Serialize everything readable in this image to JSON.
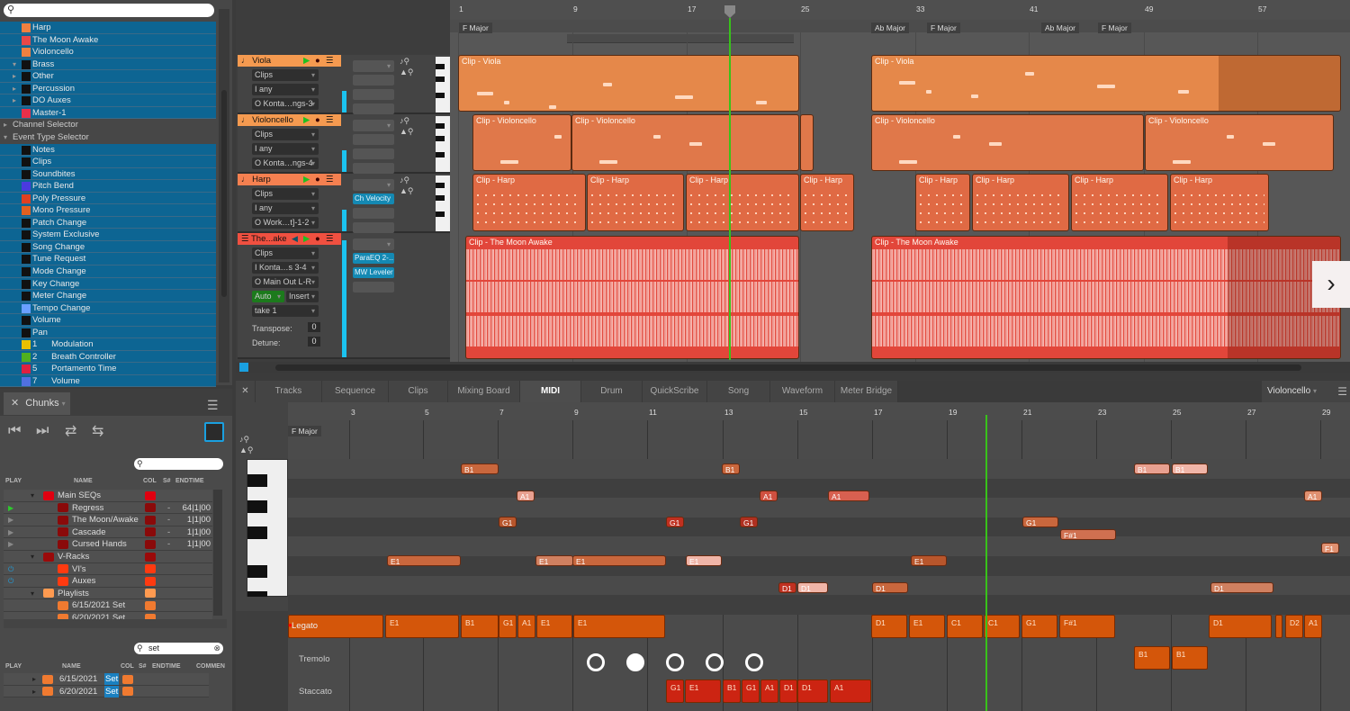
{
  "browser": {
    "search_placeholder": "",
    "items": [
      {
        "label": "Harp",
        "icon": "midi-track-icon",
        "color": "#f08040",
        "indent": 2,
        "sel": true
      },
      {
        "label": "The Moon Awake",
        "icon": "audio-track-icon",
        "color": "#e84848",
        "indent": 2,
        "sel": true
      },
      {
        "label": "Violoncello",
        "icon": "midi-track-icon",
        "color": "#f08040",
        "indent": 2,
        "sel": true
      },
      {
        "label": "Brass",
        "icon": "folder-icon",
        "color": "#111",
        "indent": 1,
        "sel": true,
        "arrow": "▾"
      },
      {
        "label": "Other",
        "icon": "folder-icon",
        "color": "#111",
        "indent": 1,
        "sel": true,
        "arrow": "▸"
      },
      {
        "label": "Percussion",
        "icon": "folder-icon",
        "color": "#111",
        "indent": 1,
        "sel": true,
        "arrow": "▸"
      },
      {
        "label": "DO Auxes",
        "icon": "folder-icon",
        "color": "#111",
        "indent": 1,
        "sel": true,
        "arrow": "▸"
      },
      {
        "label": "Master-1",
        "icon": "master-bus-icon",
        "color": "#e8304a",
        "indent": 2,
        "sel": true
      },
      {
        "label": "Channel Selector",
        "indent": 0,
        "sel": false,
        "arrow": "▸"
      },
      {
        "label": "Event Type Selector",
        "indent": 0,
        "sel": false,
        "arrow": "▾"
      },
      {
        "label": "Notes",
        "icon": "note-icon",
        "color": "#111",
        "indent": 2,
        "sel": true
      },
      {
        "label": "Clips",
        "icon": "clips-icon",
        "color": "#111",
        "indent": 2,
        "sel": true
      },
      {
        "label": "Soundbites",
        "icon": "soundbites-icon",
        "color": "#111",
        "indent": 2,
        "sel": true
      },
      {
        "label": "Pitch Bend",
        "icon": "pitch-bend-icon",
        "color": "#4a3ae0",
        "indent": 2,
        "sel": true
      },
      {
        "label": "Poly Pressure",
        "icon": "poly-pressure-icon",
        "color": "#e04020",
        "indent": 2,
        "sel": true
      },
      {
        "label": "Mono Pressure",
        "icon": "mono-pressure-icon",
        "color": "#e06020",
        "indent": 2,
        "sel": true
      },
      {
        "label": "Patch Change",
        "icon": "patch-change-icon",
        "color": "#111",
        "indent": 2,
        "sel": true
      },
      {
        "label": "System Exclusive",
        "icon": "sysex-icon",
        "color": "#111",
        "indent": 2,
        "sel": true
      },
      {
        "label": "Song Change",
        "icon": "song-change-icon",
        "color": "#111",
        "indent": 2,
        "sel": true
      },
      {
        "label": "Tune Request",
        "icon": "tune-request-icon",
        "color": "#111",
        "indent": 2,
        "sel": true
      },
      {
        "label": "Mode Change",
        "icon": "mode-change-icon",
        "color": "#111",
        "indent": 2,
        "sel": true
      },
      {
        "label": "Key Change",
        "icon": "key-change-icon",
        "color": "#111",
        "indent": 2,
        "sel": true
      },
      {
        "label": "Meter Change",
        "icon": "meter-change-icon",
        "color": "#111",
        "indent": 2,
        "sel": true
      },
      {
        "label": "Tempo Change",
        "icon": "tempo-change-icon",
        "color": "#6aa0ff",
        "indent": 2,
        "sel": true
      },
      {
        "label": "Volume",
        "icon": "volume-icon",
        "color": "#111",
        "indent": 2,
        "sel": true
      },
      {
        "label": "Pan",
        "icon": "pan-icon",
        "color": "#111",
        "indent": 2,
        "sel": true
      },
      {
        "label": "1      Modulation",
        "icon": "controller-icon",
        "color": "#e8c000",
        "indent": 2,
        "sel": true
      },
      {
        "label": "2      Breath Controller",
        "icon": "controller-icon",
        "color": "#50b020",
        "indent": 2,
        "sel": true
      },
      {
        "label": "5      Portamento Time",
        "icon": "controller-icon",
        "color": "#e02040",
        "indent": 2,
        "sel": true
      },
      {
        "label": "7      Volume",
        "icon": "controller-icon",
        "color": "#5070e0",
        "indent": 2,
        "sel": true
      }
    ]
  },
  "chunks": {
    "tab_label": "Chunks",
    "columns": [
      "PLAY",
      "NAME",
      "COL",
      "S#",
      "ENDTIME"
    ],
    "rows": [
      {
        "play": "",
        "name": "Main SEQs",
        "color": "#e00010",
        "s": "",
        "end": "",
        "level": 1,
        "folder": true
      },
      {
        "play": "▶",
        "play_color": "#2ec82e",
        "name": "Regress",
        "color": "#8a0a0a",
        "s": "-",
        "end": "64|1|00",
        "level": 2
      },
      {
        "play": "▶",
        "play_color": "#888",
        "name": "The Moon/Awake",
        "color": "#8a0a0a",
        "s": "-",
        "end": "1|1|00",
        "level": 2
      },
      {
        "play": "▶",
        "play_color": "#888",
        "name": "Cascade",
        "color": "#8a0a0a",
        "s": "-",
        "end": "1|1|00",
        "level": 2
      },
      {
        "play": "▶",
        "play_color": "#888",
        "name": "Cursed Hands",
        "color": "#8a0a0a",
        "s": "-",
        "end": "1|1|00",
        "level": 2
      },
      {
        "play": "",
        "name": "V-Racks",
        "color": "#9a0a0a",
        "s": "",
        "end": "",
        "level": 1,
        "folder": true
      },
      {
        "play": "⏻",
        "play_color": "#20a0e0",
        "name": "VI's",
        "color": "#ff3a10",
        "s": "",
        "end": "",
        "level": 2
      },
      {
        "play": "⏻",
        "play_color": "#20a0e0",
        "name": "Auxes",
        "color": "#ff3a10",
        "s": "",
        "end": "",
        "level": 2
      },
      {
        "play": "",
        "name": "Playlists",
        "color": "#ff9a50",
        "s": "",
        "end": "",
        "level": 1,
        "folder": true
      },
      {
        "play": "",
        "name": "6/15/2021 Set",
        "color": "#f07a30",
        "s": "",
        "end": "",
        "level": 2
      },
      {
        "play": "",
        "name": "6/20/2021 Set",
        "color": "#f07a30",
        "s": "",
        "end": "",
        "level": 2
      }
    ],
    "search2_value": "set",
    "columns2": [
      "PLAY",
      "NAME",
      "COL",
      "S#",
      "ENDTIME",
      "COMMEN"
    ],
    "results": [
      {
        "name": "6/15/2021",
        "hl": "Set",
        "color": "#f07a30"
      },
      {
        "name": "6/20/2021",
        "hl": "Set",
        "color": "#f07a30"
      }
    ]
  },
  "tracks": [
    {
      "name": "Viola",
      "color": "#f59a50",
      "input": "Clips",
      "channel": "I  any",
      "output": "O Konta…ngs-3",
      "fx": []
    },
    {
      "name": "Violoncello",
      "color": "#f59a50",
      "input": "Clips",
      "channel": "I  any",
      "output": "O Konta…ngs-4",
      "fx": []
    },
    {
      "name": "Harp",
      "color": "#f58050",
      "input": "Clips",
      "channel": "I  any",
      "output": "O Work…t]-1-2",
      "fx": [
        "Ch Velocity"
      ]
    },
    {
      "name": "The...ake",
      "color": "#f05040",
      "input": "Clips",
      "channel": "I  Konta…s 3-4",
      "output": "O Main Out L-R",
      "auto": "Auto",
      "insert": "Insert",
      "take": "take 1",
      "transpose_label": "Transpose:",
      "transpose": "0",
      "detune_label": "Detune:",
      "detune": "0",
      "fx": [
        "ParaEQ 2-…",
        "MW Leveler"
      ]
    }
  ],
  "arrange": {
    "bars": [
      "1",
      "9",
      "17",
      "25",
      "33",
      "41",
      "49",
      "57"
    ],
    "key_signatures": [
      "F Major",
      "Ab Major",
      "F Major",
      "Ab Major",
      "F Major"
    ],
    "clips": {
      "viola": [
        "Clip - Viola",
        "Clip - Viola"
      ],
      "violoncello": [
        "Clip - Violoncello",
        "Clip - Violoncello",
        "Clip - Violoncello",
        "Clip - Violoncello"
      ],
      "harp": [
        "Clip - Harp",
        "Clip - Harp",
        "Clip - Harp",
        "Clip - Harp",
        "Clip - Harp",
        "Clip - Harp",
        "Clip - Harp",
        "Clip - Harp"
      ],
      "moon": [
        "Clip - The Moon Awake",
        "Clip - The Moon Awake"
      ]
    }
  },
  "bottom_tabs": [
    "Tracks",
    "Sequence",
    "Clips",
    "Mixing Board",
    "MIDI",
    "Drum",
    "QuickScribe",
    "Song",
    "Waveform",
    "Meter Bridge"
  ],
  "active_tab": "MIDI",
  "track_selector": "Violoncello",
  "piano_roll": {
    "bars": [
      "3",
      "5",
      "7",
      "9",
      "11",
      "13",
      "15",
      "17",
      "19",
      "21",
      "23",
      "25",
      "27",
      "29"
    ],
    "key_label": "F Major",
    "articulation_lanes": [
      "Legato",
      "Tremolo",
      "Staccato"
    ],
    "legato_notes": [
      "E1",
      "B1",
      "G1",
      "A1",
      "E1",
      "E1",
      "D1",
      "E1",
      "C1",
      "C1",
      "G1",
      "F#1",
      "D1",
      "D2",
      "A1",
      "F1"
    ],
    "tremolo_notes": [
      "B1",
      "B1"
    ],
    "staccato_notes": [
      "G1",
      "E1",
      "B1",
      "G1",
      "A1",
      "D1",
      "D1",
      "A1"
    ],
    "notes": [
      {
        "n": "B1"
      },
      {
        "n": "B1"
      },
      {
        "n": "B1"
      },
      {
        "n": "B1"
      },
      {
        "n": "A1"
      },
      {
        "n": "A1"
      },
      {
        "n": "A1"
      },
      {
        "n": "A1"
      },
      {
        "n": "G1"
      },
      {
        "n": "G1"
      },
      {
        "n": "G1"
      },
      {
        "n": "G1"
      },
      {
        "n": "G1"
      },
      {
        "n": "F#1"
      },
      {
        "n": "F1"
      },
      {
        "n": "E1"
      },
      {
        "n": "E1"
      },
      {
        "n": "E1"
      },
      {
        "n": "E1"
      },
      {
        "n": "E1"
      },
      {
        "n": "E1"
      },
      {
        "n": "D1"
      },
      {
        "n": "D1"
      },
      {
        "n": "D1"
      },
      {
        "n": "D1"
      }
    ]
  }
}
